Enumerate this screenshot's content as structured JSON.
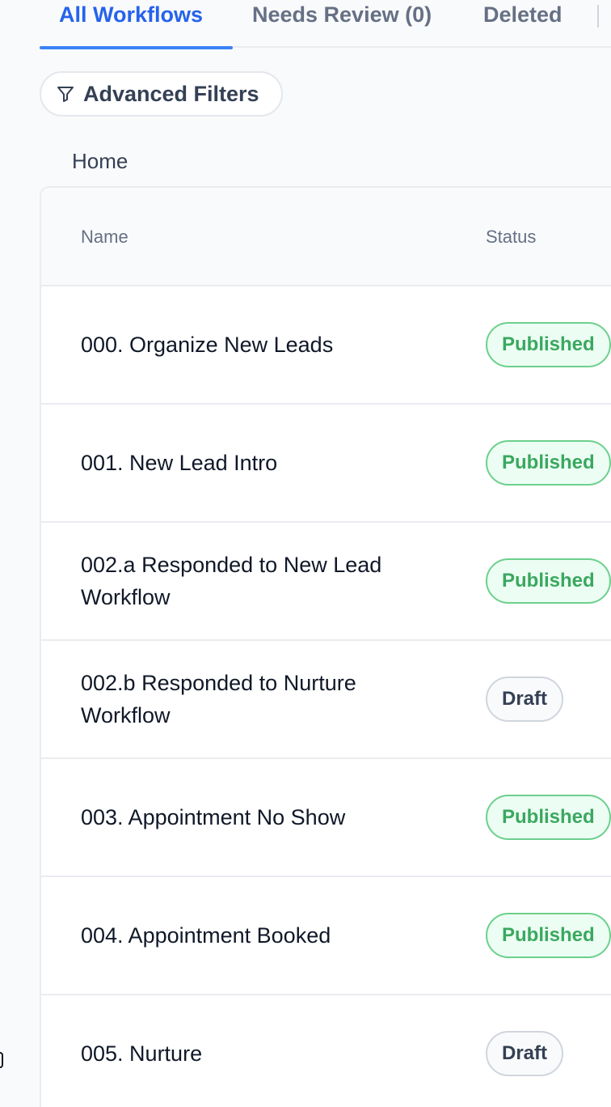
{
  "tabs": [
    {
      "label": "All Workflows",
      "active": true
    },
    {
      "label": "Needs Review (0)",
      "active": false
    },
    {
      "label": "Deleted",
      "active": false
    }
  ],
  "filters": {
    "label": "Advanced Filters",
    "icon": "filter-icon"
  },
  "breadcrumb": "Home",
  "table": {
    "columns": {
      "name": "Name",
      "status": "Status"
    },
    "rows": [
      {
        "name": "000. Organize New Leads",
        "status": "Published"
      },
      {
        "name": "001. New Lead Intro",
        "status": "Published"
      },
      {
        "name": "002.a Responded to New Lead Workflow",
        "status": "Published"
      },
      {
        "name": "002.b Responded to Nurture Workflow",
        "status": "Draft"
      },
      {
        "name": "003. Appointment No Show",
        "status": "Published"
      },
      {
        "name": "004. Appointment Booked",
        "status": "Published"
      },
      {
        "name": "005. Nurture",
        "status": "Draft"
      }
    ]
  },
  "colors": {
    "accent": "#2563eb",
    "published": "#3aa85f",
    "draft": "#344054"
  }
}
